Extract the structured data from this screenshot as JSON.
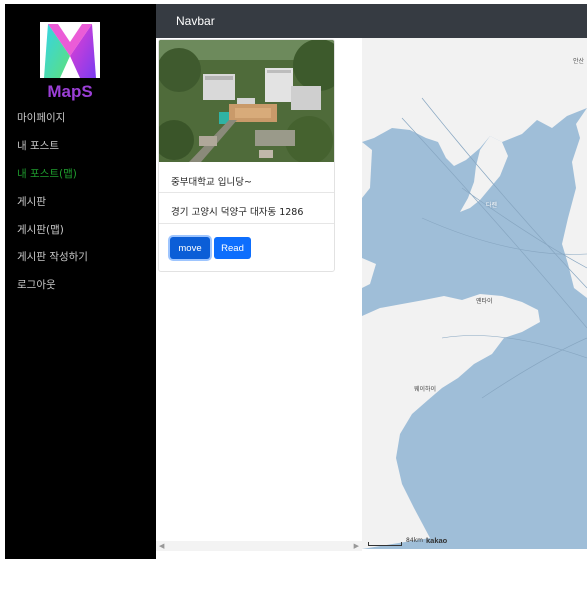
{
  "app": {
    "logo_text": "MapS"
  },
  "sidebar": {
    "items": [
      {
        "label": "마이페이지",
        "active": false
      },
      {
        "label": "내 포스트",
        "active": false
      },
      {
        "label": "내 포스트(맵)",
        "active": true
      },
      {
        "label": "게시판",
        "active": false
      },
      {
        "label": "게시판(맵)",
        "active": false
      },
      {
        "label": "게시판 작성하기",
        "active": false
      },
      {
        "label": "로그아웃",
        "active": false
      }
    ]
  },
  "navbar": {
    "brand": "Navbar"
  },
  "post_card": {
    "title": "중부대학교 입니당~",
    "address": "경기 고양시 덕양구 대자동 1286",
    "move_label": "move",
    "read_label": "Read"
  },
  "map": {
    "labels": {
      "top_right": "안산",
      "dalian": "다롄",
      "yantai": "옌타이",
      "weihai": "웨이하이"
    },
    "scale_text": "84km",
    "provider": "kakao"
  },
  "colors": {
    "sidebar_bg": "#000000",
    "active_nav": "#1f9e2e",
    "navbar_bg": "#363b42",
    "primary_button": "#0d6efd",
    "sea": "#9fbed8",
    "land": "#f2f2f2"
  }
}
